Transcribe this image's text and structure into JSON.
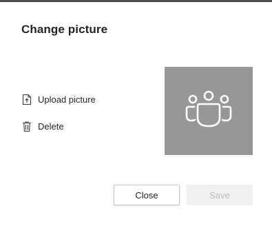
{
  "dialog": {
    "title": "Change picture"
  },
  "actions": {
    "upload_label": "Upload picture",
    "upload_icon": "upload-file-icon",
    "delete_label": "Delete",
    "delete_icon": "trash-icon"
  },
  "preview": {
    "icon": "team-people-icon",
    "background_color": "#979797",
    "icon_color": "#ffffff"
  },
  "buttons": {
    "close_label": "Close",
    "save_label": "Save",
    "save_disabled": true
  }
}
